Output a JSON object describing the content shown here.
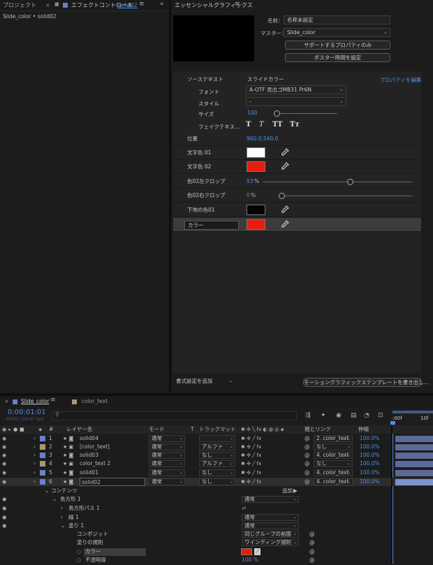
{
  "project_panel": {
    "tab_project": "プロジェクト",
    "tab_effects": "エフェクトコントロール",
    "tab_effects_target": "solid02",
    "breadcrumb": "Slide_color • solid02"
  },
  "eg_panel": {
    "title": "エッセンシャルグラフィックス",
    "name_label": "名前：",
    "name_value": "名称未設定",
    "master_label": "マスター：",
    "master_value": "Slide_color",
    "btn_supported_only": "サポートするプロパティのみ",
    "btn_poster_time": "ポスター時間を設定",
    "source_text_label": "ソーステキスト",
    "source_text_value": "スライドカラー",
    "edit_properties": "プロパティを編集",
    "font_label": "フォント",
    "font_value": "A-OTF 見出ゴMB31 Pr6N",
    "style_label": "スタイル",
    "style_value": "-",
    "size_label": "サイズ",
    "size_value": "100",
    "faux_label": "フェイクテキス...",
    "faux_buttons": [
      "T",
      "T",
      "TT",
      "Tт"
    ],
    "rows": [
      {
        "label": "位置",
        "value": "960.0,540.0"
      },
      {
        "label": "文字色 01",
        "color": "#ffffff"
      },
      {
        "label": "文字色 02",
        "color": "#e81c0d"
      },
      {
        "label": "色02左クロップ",
        "value": "53",
        "unit": "%",
        "level": 0.53
      },
      {
        "label": "色02右クロップ",
        "value": "0",
        "unit": "%",
        "level": 0
      },
      {
        "label": "下地の色01",
        "color": "#000000"
      },
      {
        "label": "カラー",
        "color": "#e81c0d"
      }
    ],
    "add_formatting": "書式設定を追加",
    "export_button": "モーショングラフィックステンプレートを書き出し..."
  },
  "timeline": {
    "tab_active": "Slide_color",
    "tab_other": "color_text",
    "timecode": "0:00:01:01",
    "frame_info": "00031 (29.97 fps)",
    "ruler_start": ":00f",
    "ruler_mark": "10f",
    "headers": {
      "num": "#",
      "layer_name": "レイヤー名",
      "mode": "モード",
      "t": "T",
      "track_matte": "トラックマット",
      "parent": "親とリンク",
      "stretch": "伸縮"
    },
    "layers": [
      {
        "num": "1",
        "name": "solid04",
        "color": "#6a80c8",
        "mode": "通常",
        "matte": "",
        "parent": "2. color_text",
        "stretch": "100.0%"
      },
      {
        "num": "2",
        "name": "[color_text]",
        "color": "#a89878",
        "mode": "通常",
        "matte": "アルファ",
        "parent": "なし",
        "stretch": "100.0%"
      },
      {
        "num": "3",
        "name": "solid03",
        "color": "#6a80c8",
        "mode": "通常",
        "matte": "なし",
        "parent": "4. color_text",
        "stretch": "100.0%"
      },
      {
        "num": "4",
        "name": "color_text 2",
        "color": "#a89878",
        "mode": "通常",
        "matte": "アルファ",
        "parent": "なし",
        "stretch": "100.0%"
      },
      {
        "num": "5",
        "name": "solid01",
        "color": "#6a80c8",
        "mode": "通常",
        "matte": "なし",
        "parent": "4. color_text",
        "stretch": "100.0%"
      },
      {
        "num": "6",
        "name": "solid02",
        "color": "#6a80c8",
        "mode": "通常",
        "matte": "なし",
        "parent": "4. color_text",
        "stretch": "100.0%"
      }
    ],
    "tree": {
      "contents": "コンテンツ",
      "add_label": "追加：",
      "rect1": "長方形 1",
      "rect1_mode": "通常",
      "rect_path": "長方形パス 1",
      "stroke": "線 1",
      "stroke_mode": "通常",
      "fill": "塗り 1",
      "fill_mode": "通常",
      "composite": "コンポジット",
      "composite_value": "同じグループの前面",
      "fill_rule": "塗りの規則",
      "fill_rule_value": "ワインディング規則",
      "color": "カラー",
      "color_value": "#e81c0d",
      "opacity": "不透明度",
      "opacity_value": "100 %"
    }
  }
}
